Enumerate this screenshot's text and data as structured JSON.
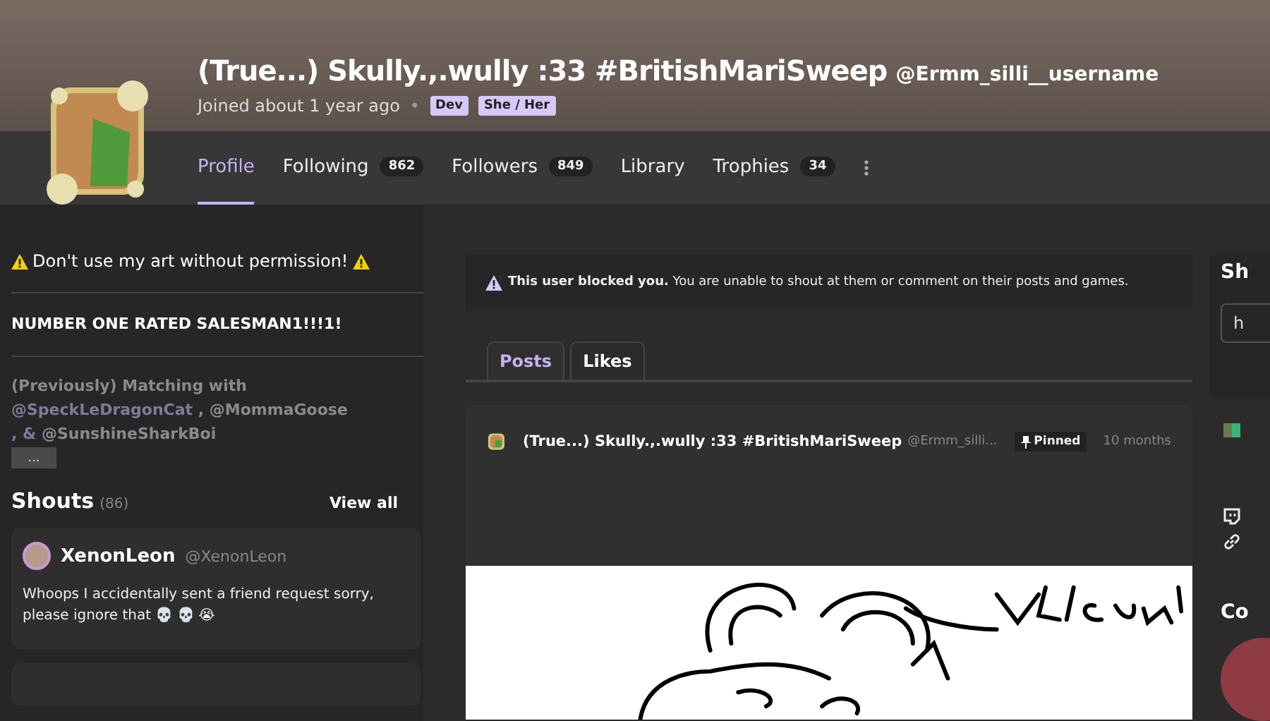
{
  "profile": {
    "display_name": "(True...) Skully.,.wully :33 #BritishMariSweep",
    "username": "@Ermm_silli__username",
    "joined": "Joined about 1 year ago",
    "separator": "•",
    "badges": [
      "Dev",
      "She / Her"
    ]
  },
  "nav": [
    {
      "label": "Profile",
      "selected": true
    },
    {
      "label": "Following",
      "count": "862",
      "selected": false
    },
    {
      "label": "Followers",
      "count": "849",
      "selected": false
    },
    {
      "label": "Library",
      "selected": false
    },
    {
      "label": "Trophies",
      "count": "34",
      "selected": false
    }
  ],
  "bio": {
    "warning": "Don't use my art without permission!",
    "motto": "NUMBER ONE RATED SALESMAN1!!!1!",
    "matching_intro": "(Previously) Matching with",
    "matching_names": [
      "@SpeckLeDragonCat",
      ", @MommaGoose",
      ", &",
      "@SunshineSharkBoi"
    ],
    "more_button": "..."
  },
  "shouts": {
    "title": "Shouts",
    "count": "(86)",
    "view_all": "View all",
    "items": [
      {
        "name": "XenonLeon",
        "handle": "@XenonLeon",
        "text": "Whoops I accidentally sent a friend request sorry, please ignore that 💀 💀 😭"
      }
    ]
  },
  "notice": {
    "bold": "This user blocked you.",
    "text": "You are unable to shout at them or comment on their posts and games."
  },
  "feed_tabs": [
    {
      "label": "Posts",
      "selected": true
    },
    {
      "label": "Likes",
      "selected": false
    }
  ],
  "post": {
    "author": "(True...) Skully.,.wully :33 #BritishMariSweep",
    "handle": "@Ermm_silli...",
    "pinned": "Pinned",
    "time": "10 months"
  },
  "right": {
    "heading": "Sh",
    "field_value": "h",
    "section_heading": "Co"
  }
}
